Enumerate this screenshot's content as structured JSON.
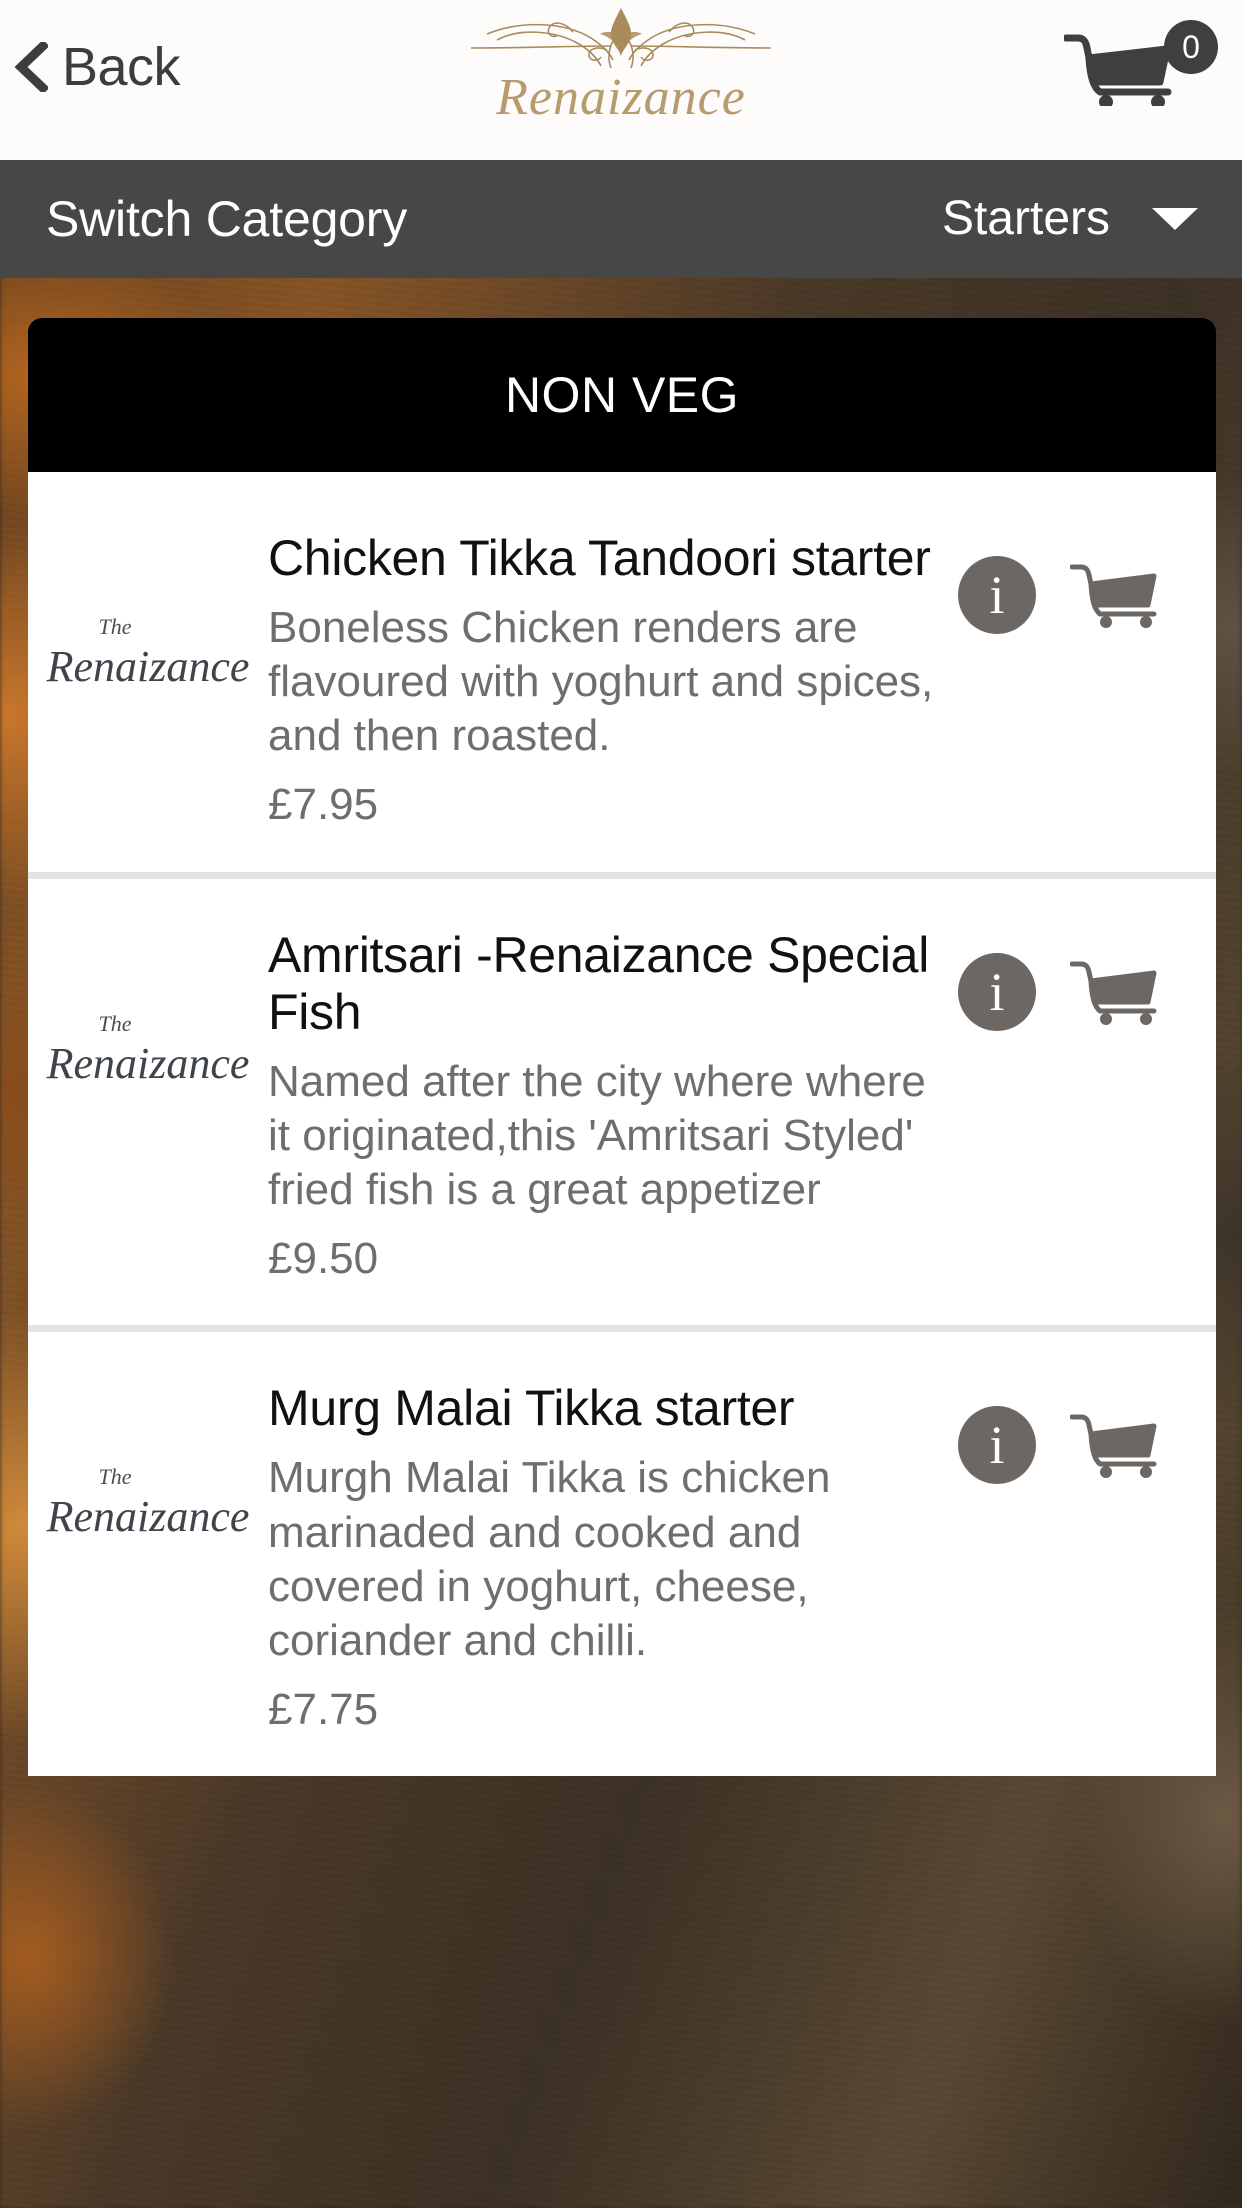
{
  "header": {
    "back_label": "Back",
    "back_icon": "chevron-left-icon",
    "brand_name": "Renaizance",
    "cart_icon": "shopping-cart-icon",
    "cart_count": "0"
  },
  "category_bar": {
    "label": "Switch Category",
    "selected": "Starters",
    "caret_icon": "chevron-down-icon"
  },
  "section": {
    "banner_label": "NON VEG"
  },
  "thumb": {
    "the": "The",
    "name": "Renaizance"
  },
  "colors": {
    "brand_gold": "#b79a6d",
    "category_bar": "#474745",
    "banner": "#000000",
    "icon_gray": "#6d6763",
    "divider": "#e3e3e3"
  },
  "items": [
    {
      "title": "Chicken Tikka Tandoori starter",
      "description": "Boneless Chicken renders are flavoured with yoghurt and spices, and then roasted.",
      "price": "£7.95",
      "info_icon": "info-icon",
      "add_icon": "shopping-cart-icon"
    },
    {
      "title": "Amritsari -Renaizance Special Fish",
      "description": "Named after the city where where it originated,this 'Amritsari Styled' fried fish is a great appetizer",
      "price": "£9.50",
      "info_icon": "info-icon",
      "add_icon": "shopping-cart-icon"
    },
    {
      "title": "Murg Malai Tikka starter",
      "description": "Murgh Malai Tikka is chicken marinaded and cooked and covered in yoghurt, cheese, coriander and chilli.",
      "price": "£7.75",
      "info_icon": "info-icon",
      "add_icon": "shopping-cart-icon"
    }
  ]
}
